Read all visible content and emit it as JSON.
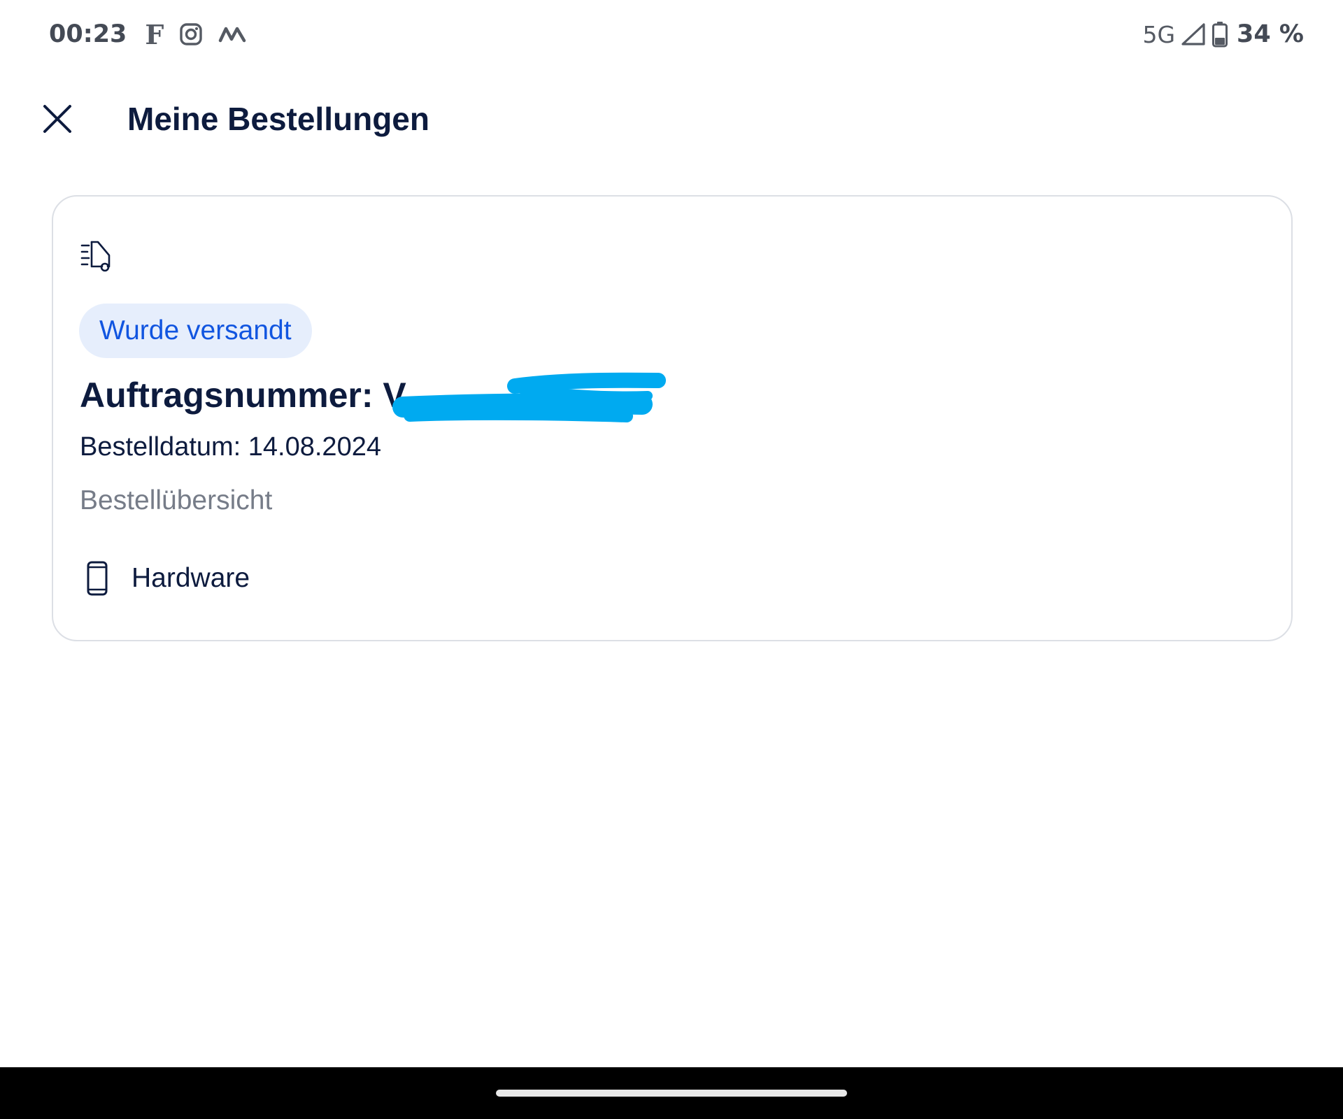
{
  "status_bar": {
    "time": "00:23",
    "app_letter": "F",
    "notification_icons": [
      "facebook-f-icon",
      "instagram-icon",
      "m-app-icon"
    ],
    "network": "5G",
    "signal_icon": "signal-icon",
    "battery_icon": "battery-icon",
    "battery_percent": "34 %"
  },
  "app_bar": {
    "close_icon": "close-icon",
    "title": "Meine Bestellungen"
  },
  "order": {
    "icon": "delivery-truck-icon",
    "status": "Wurde versandt",
    "order_number_label": "Auftragsnummer: V",
    "order_date": "Bestelldatum: 14.08.2024",
    "overview_link": "Bestellübersicht",
    "item_icon": "smartphone-icon",
    "item_label": "Hardware"
  },
  "colors": {
    "accent": "#1155e0",
    "chip_background": "#e6eefc",
    "text_primary": "#0d1b3e",
    "text_secondary": "#767c88",
    "card_border": "#dcdfe5",
    "redaction": "#00aaf0"
  }
}
